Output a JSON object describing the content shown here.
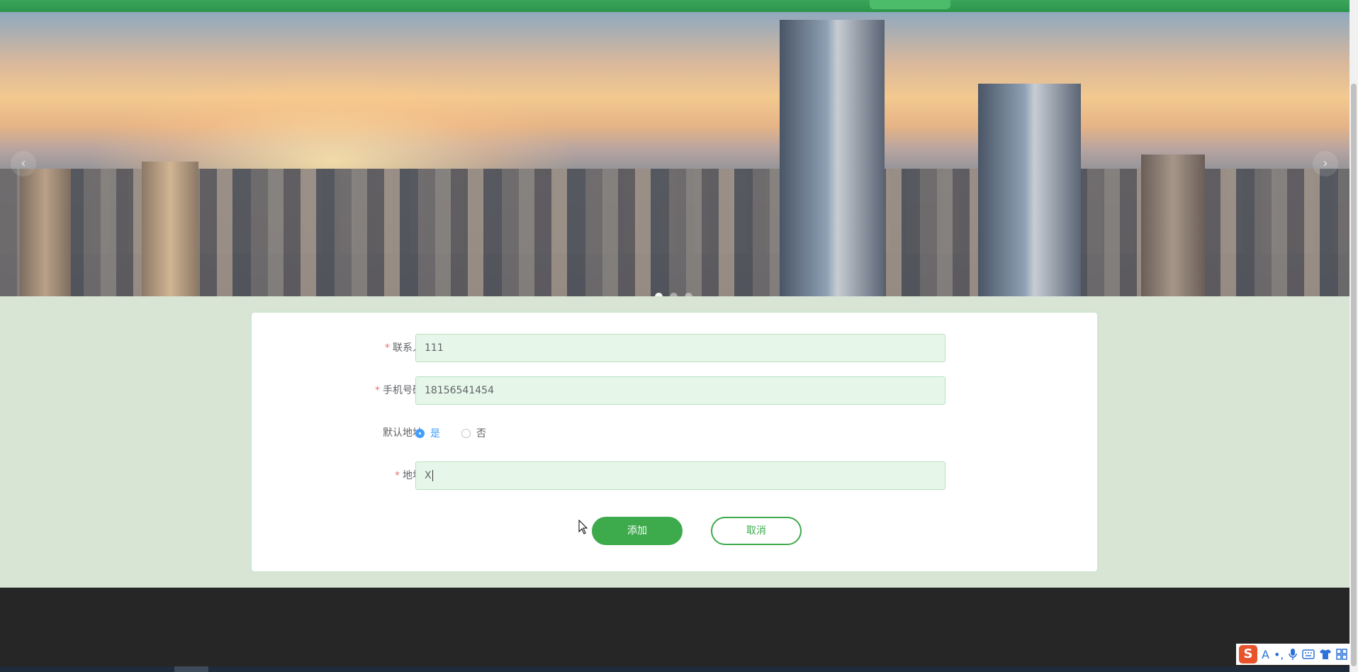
{
  "banner": {
    "prev_arrow": "‹",
    "next_arrow": "›",
    "slides_count": 3,
    "active_slide": 1
  },
  "form": {
    "contact": {
      "label": "联系人",
      "value": "111",
      "required": true
    },
    "phone": {
      "label": "手机号码",
      "value": "18156541454",
      "required": true
    },
    "default_address": {
      "label": "默认地址",
      "options": [
        "是",
        "否"
      ],
      "selected": "是"
    },
    "address": {
      "label": "地址",
      "value": "X",
      "required": true
    },
    "required_mark": "*"
  },
  "buttons": {
    "add": "添加",
    "cancel": "取消"
  },
  "ime": {
    "logo": "S",
    "mode": "A",
    "punct": "•,"
  },
  "colors": {
    "brand_green": "#3daa4c",
    "input_bg": "#e6f7ea",
    "required_red": "#f56c6c",
    "radio_blue": "#409eff",
    "footer": "#262626"
  }
}
